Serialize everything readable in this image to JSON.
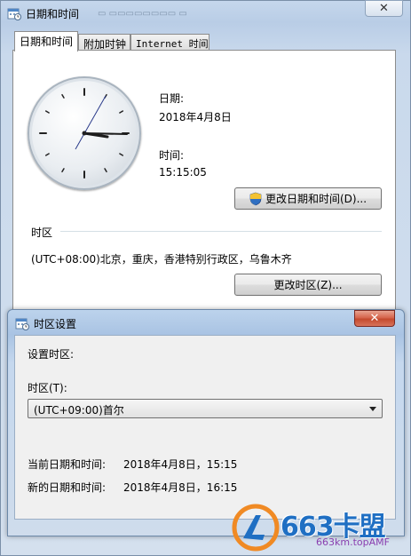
{
  "outer_window": {
    "title": "日期和时间",
    "tabs": [
      {
        "label": "日期和时间"
      },
      {
        "label": "附加时钟"
      },
      {
        "label": "Internet 时间"
      }
    ],
    "date_label": "日期:",
    "date_value": "2018年4月8日",
    "time_label": "时间:",
    "time_value": "15:15:05",
    "change_datetime_button": "更改日期和时间(D)...",
    "timezone_heading": "时区",
    "timezone_value": "(UTC+08:00)北京，重庆，香港特别行政区，乌鲁木齐",
    "change_timezone_button": "更改时区(Z)..."
  },
  "dialog": {
    "title": "时区设置",
    "set_timezone_label": "设置时区:",
    "timezone_field_label": "时区(T):",
    "timezone_selected": "(UTC+09:00)首尔",
    "current_datetime_label": "当前日期和时间:",
    "current_datetime_value": "2018年4月8日，15:15",
    "new_datetime_label": "新的日期和时间:",
    "new_datetime_value": "2018年4月8日，16:15"
  },
  "watermark": {
    "text": "663卡盟",
    "url": "663km.topAMF"
  },
  "icons": {
    "title_icon": "calendar-clock-icon",
    "shield": "uac-shield-icon",
    "close": "close-icon",
    "dropdown": "chevron-down-icon"
  },
  "colors": {
    "close_red": "#c44a2e",
    "title_bar_blue": "#b9cde6",
    "watermark_blue": "#1f6fc3"
  }
}
